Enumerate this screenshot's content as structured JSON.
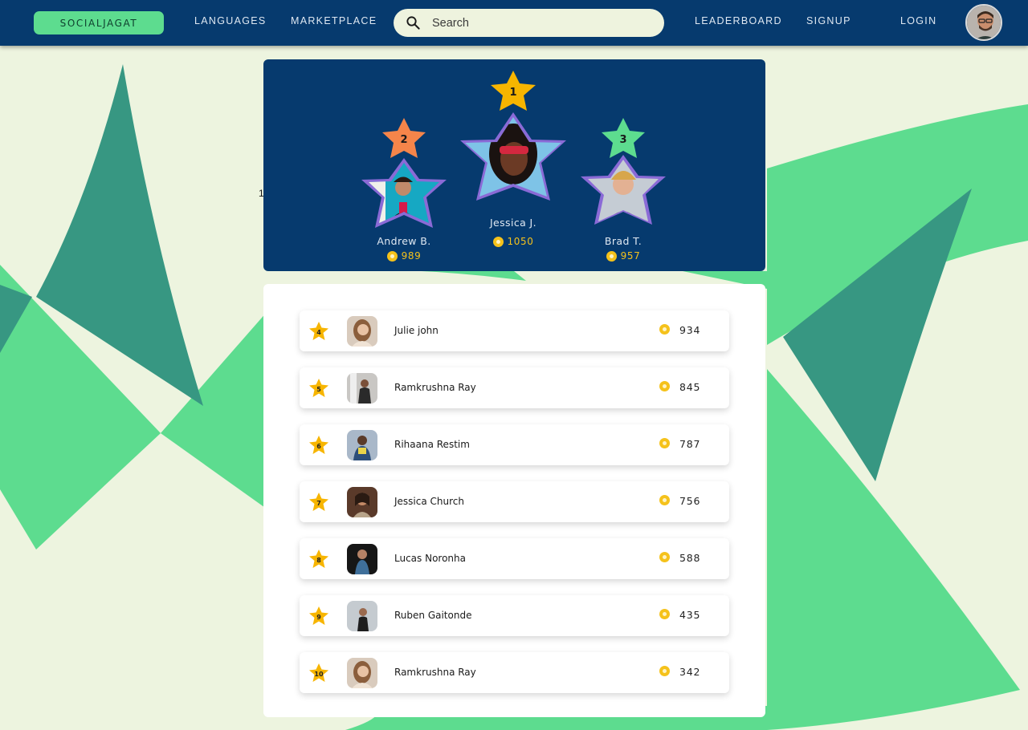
{
  "nav": {
    "brand": "SOCIALJAGAT",
    "links": [
      "LANGUAGES",
      "MARKETPLACE",
      "LEADERBOARD",
      "SIGNUP",
      "LOGIN"
    ],
    "search_placeholder": "Search"
  },
  "stray_text": "1",
  "podium": [
    {
      "rank": "1",
      "name": "Jessica J.",
      "score": "1050",
      "star_color": "#f7b500"
    },
    {
      "rank": "2",
      "name": "Andrew B.",
      "score": "989",
      "star_color": "#f5854a"
    },
    {
      "rank": "3",
      "name": "Brad T.",
      "score": "957",
      "star_color": "#5ddc8f"
    }
  ],
  "leaderboard": [
    {
      "rank": "4",
      "name": "Julie john",
      "score": "934"
    },
    {
      "rank": "5",
      "name": "Ramkrushna Ray",
      "score": "845"
    },
    {
      "rank": "6",
      "name": "Rihaana Restim",
      "score": "787"
    },
    {
      "rank": "7",
      "name": "Jessica Church",
      "score": "756"
    },
    {
      "rank": "8",
      "name": "Lucas Noronha",
      "score": "588"
    },
    {
      "rank": "9",
      "name": "Ruben Gaitonde",
      "score": "435"
    },
    {
      "rank": "10",
      "name": "Ramkrushna Ray",
      "score": "342"
    }
  ],
  "colors": {
    "navy": "#063a6e",
    "green": "#5ddc8f",
    "dark_green": "#379782",
    "gold": "#f5c21b",
    "background": "#edf4df"
  }
}
